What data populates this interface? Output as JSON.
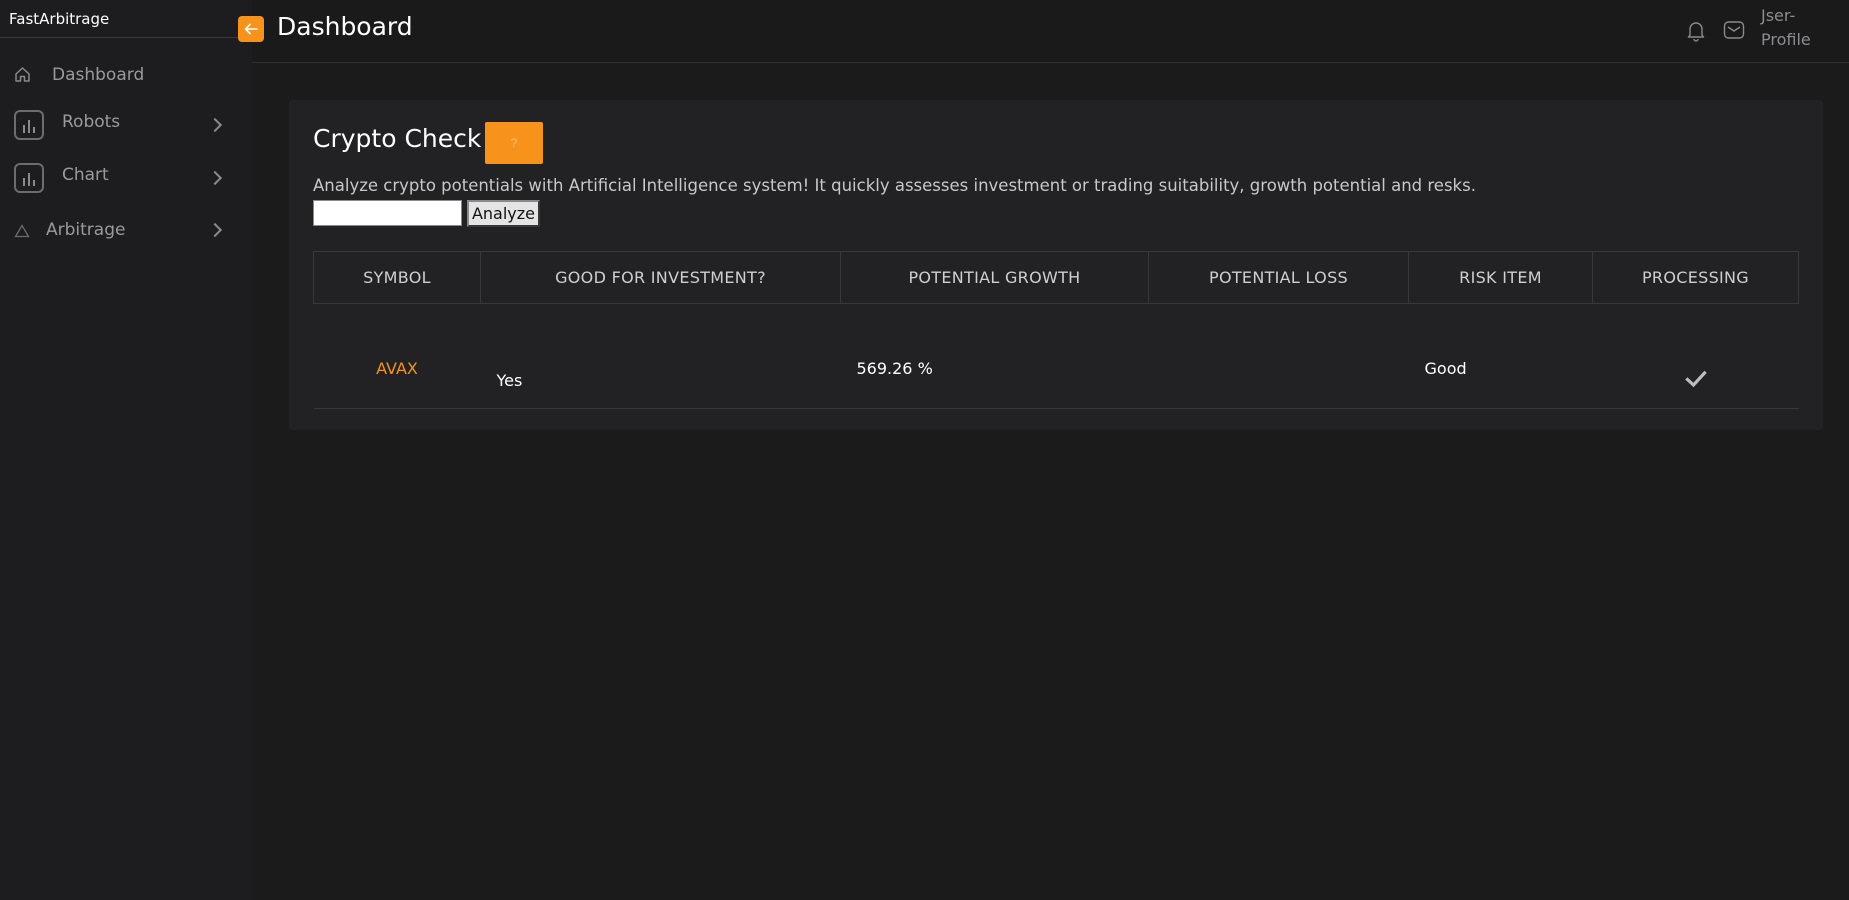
{
  "app": {
    "brand": "FastArbitrage"
  },
  "sidebar": {
    "items": [
      {
        "label": "Dashboard",
        "icon": "home-icon"
      },
      {
        "label": "Robots",
        "icon": "bar-chart-icon"
      },
      {
        "label": "Chart",
        "icon": "bar-chart-icon"
      },
      {
        "label": "Arbitrage",
        "icon": "triangle-icon"
      }
    ]
  },
  "header": {
    "title": "Dashboard",
    "user_line1": "Jser-",
    "user_line2": "Profile"
  },
  "card": {
    "title": "Crypto Check",
    "help_label": "?",
    "description": "Analyze crypto potentials with Artificial Intelligence system! It quickly assesses investment or trading suitability, growth potential and resks.",
    "input_value": "",
    "analyze_label": "Analyze"
  },
  "table": {
    "columns": [
      "SYMBOL",
      "GOOD FOR INVESTMENT?",
      "POTENTIAL GROWTH",
      "POTENTIAL LOSS",
      "RISK ITEM",
      "PROCESSING"
    ],
    "rows": [
      {
        "symbol": "AVAX",
        "good_for_investment": "Yes",
        "potential_growth": "569.26 %",
        "potential_loss": "",
        "risk_item": "Good",
        "processing": "done"
      }
    ]
  },
  "colors": {
    "accent": "#f7931a",
    "background": "#1a1a1b",
    "card": "#222224"
  }
}
